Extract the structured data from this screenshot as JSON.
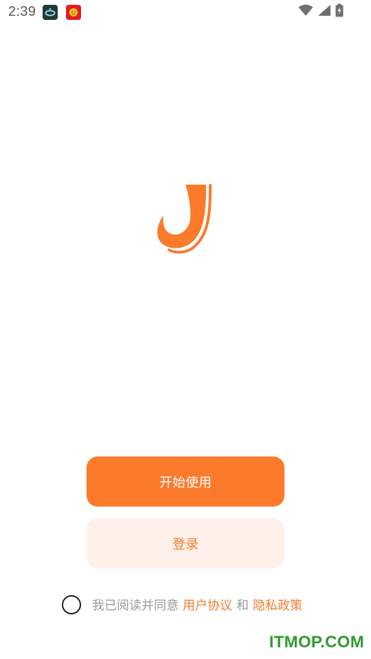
{
  "status_bar": {
    "time": "2:39",
    "notifications": [
      "app-icon",
      "red-envelope-icon"
    ],
    "icons": [
      "wifi-icon",
      "signal-icon",
      "battery-charging-icon"
    ]
  },
  "logo": {
    "icon": "orange-j-logo",
    "color": "#fb7a2b"
  },
  "actions": {
    "start_label": "开始使用",
    "login_label": "登录"
  },
  "agreement": {
    "prefix": "我已阅读并同意",
    "user_agreement": "用户协议",
    "conjunction": "和",
    "privacy_policy": "隐私政策"
  },
  "watermark": {
    "text": "ITMOP.COM"
  },
  "colors": {
    "accent": "#fb7a2b",
    "accent_light": "#fff1ea",
    "link": "#f27a2e",
    "muted_text": "#9a9a9a",
    "watermark": "#2e9a2e"
  }
}
